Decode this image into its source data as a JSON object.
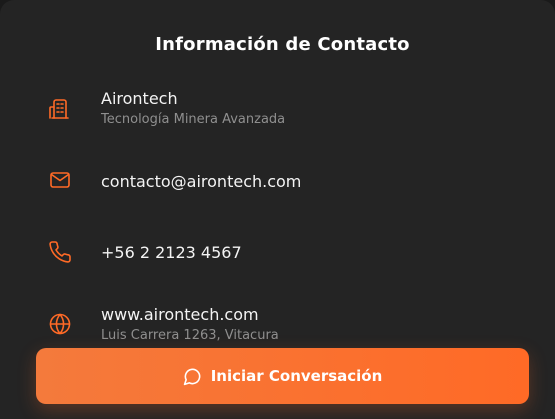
{
  "card": {
    "title": "Información de Contacto"
  },
  "contacts": [
    {
      "icon": "building-icon",
      "primary": "Airontech",
      "secondary": "Tecnología Minera Avanzada"
    },
    {
      "icon": "mail-icon",
      "primary": "contacto@airontech.com"
    },
    {
      "icon": "phone-icon",
      "primary": "+56 2 2123 4567"
    },
    {
      "icon": "globe-icon",
      "primary": "www.airontech.com",
      "secondary": "Luis Carrera 1263, Vitacura"
    }
  ],
  "cta": {
    "icon": "chat-bubble-icon",
    "label": "Iniciar Conversación"
  },
  "colors": {
    "accent": "#ff6a26",
    "card_bg": "#242424",
    "text_primary": "#f4f4f4",
    "text_secondary": "#8f8f8f"
  }
}
